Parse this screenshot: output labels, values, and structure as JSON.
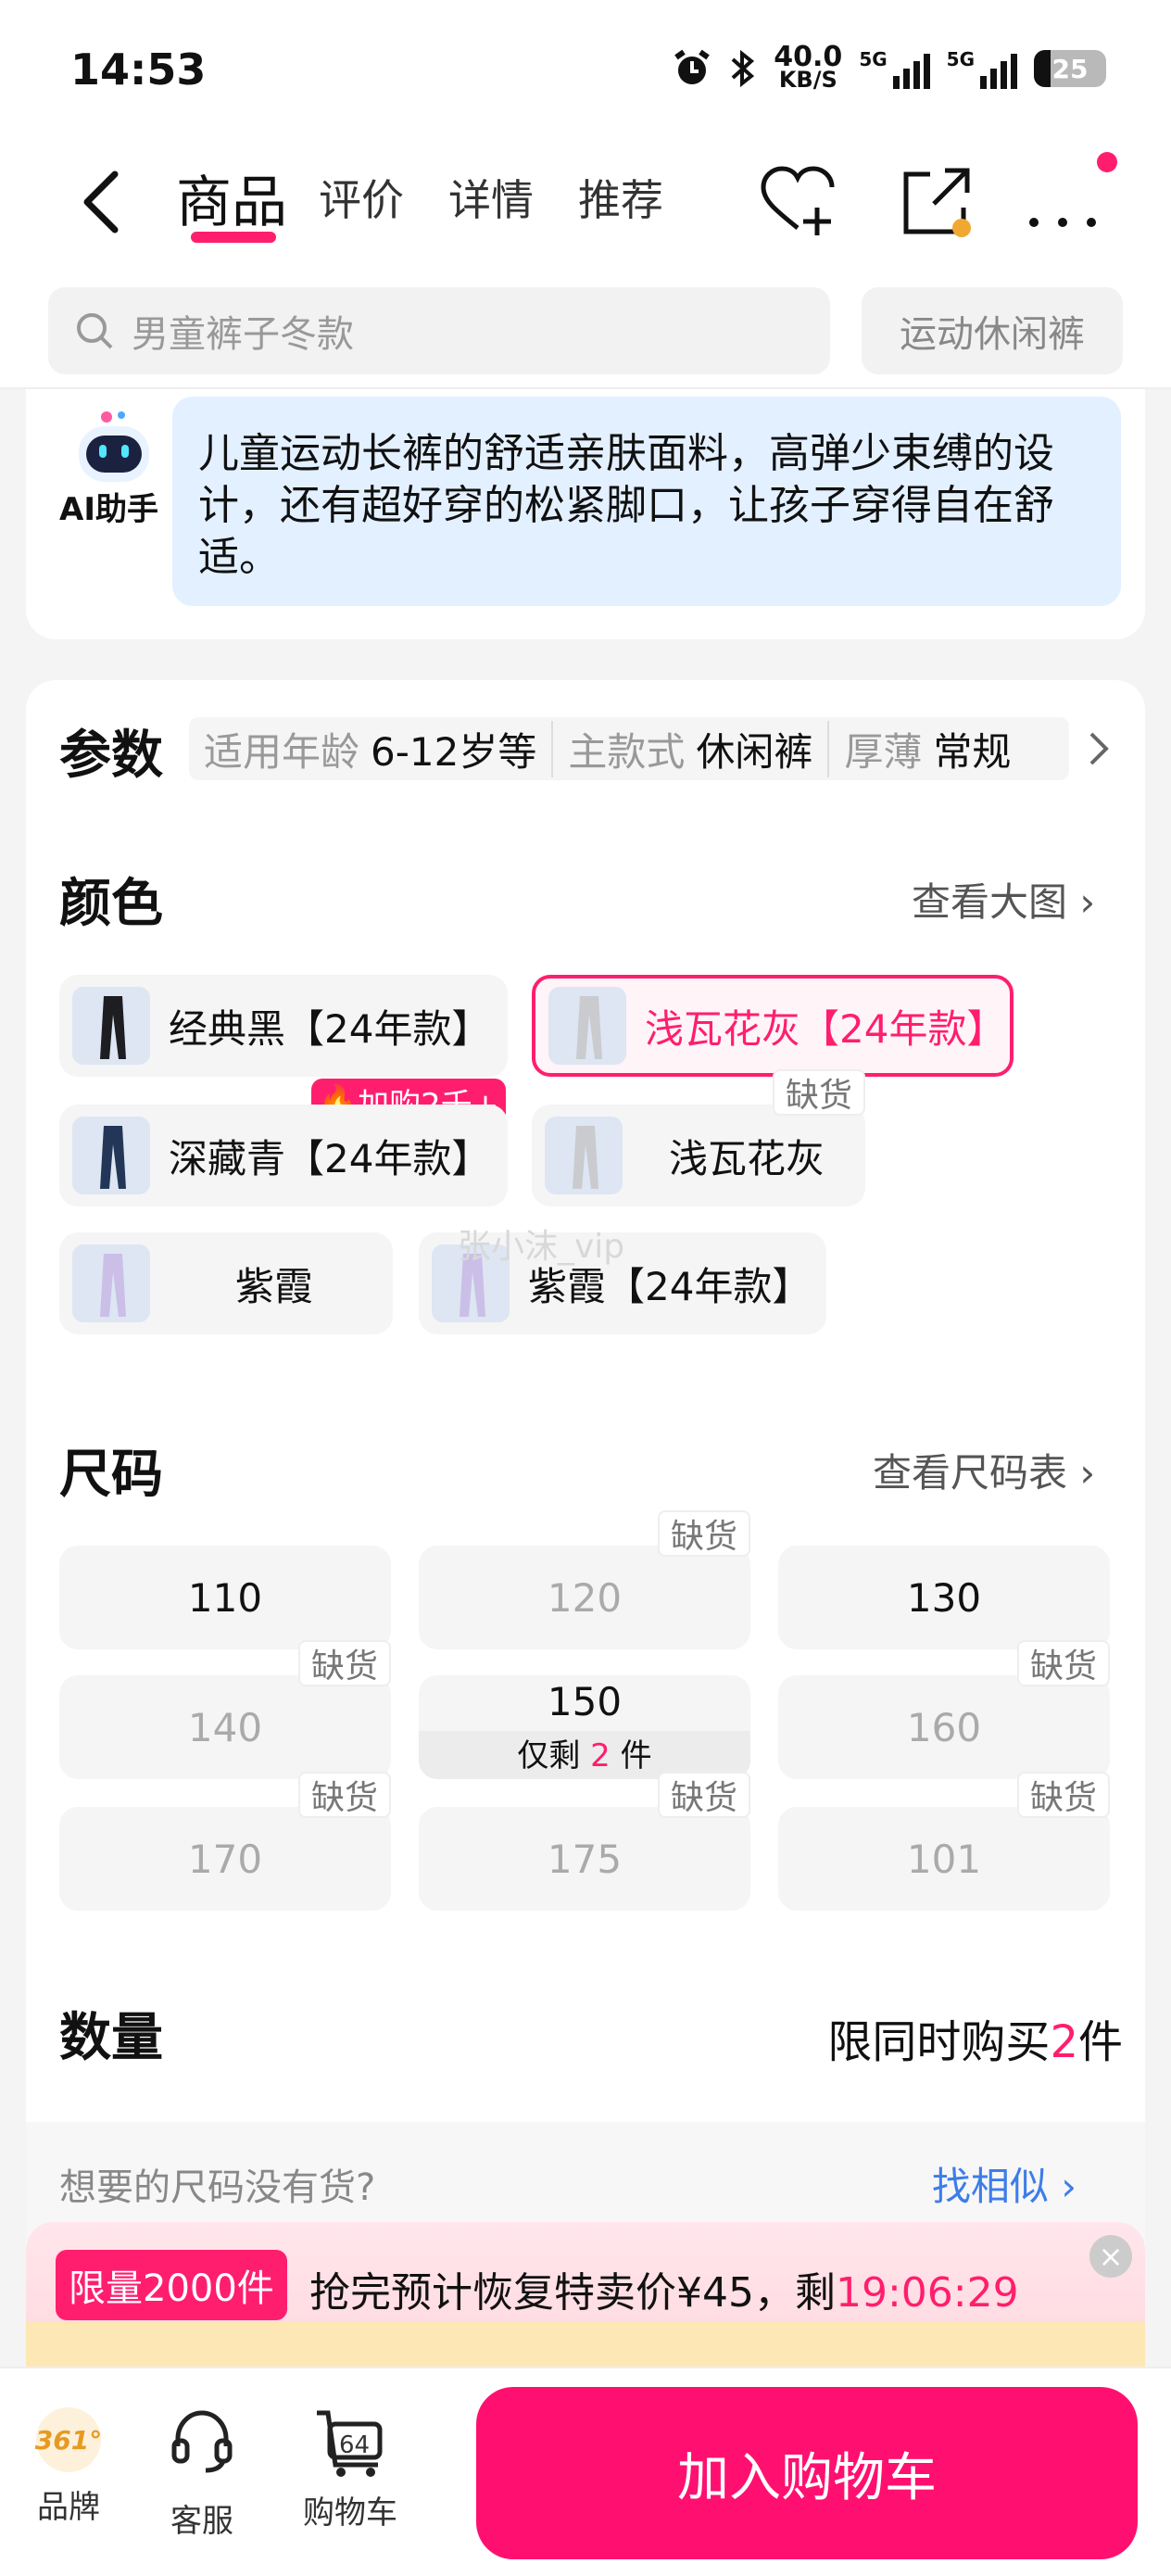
{
  "status": {
    "time": "14:53",
    "net_speed": "40.0",
    "net_unit": "KB/S",
    "sig1": "5G",
    "sig2": "5G",
    "battery": "25"
  },
  "nav": {
    "tabs": [
      "商品",
      "评价",
      "详情",
      "推荐"
    ]
  },
  "search": {
    "placeholder": "男童裤子冬款",
    "chip": "运动休闲裤"
  },
  "ai": {
    "label": "AI助手",
    "text": "儿童运动长裤的舒适亲肤面料，高弹少束缚的设计，还有超好穿的松紧脚口，让孩子穿得自在舒适。"
  },
  "params": {
    "title": "参数",
    "items": [
      {
        "k": "适用年龄",
        "v": "6-12岁等"
      },
      {
        "k": "主款式",
        "v": "休闲裤"
      },
      {
        "k": "厚薄",
        "v": "常规"
      }
    ]
  },
  "color": {
    "title": "颜色",
    "link": "查看大图",
    "options": [
      "经典黑【24年款】",
      "浅瓦花灰【24年款】",
      "深藏青【24年款】",
      "浅瓦花灰",
      "紫霞",
      "紫霞【24年款】"
    ],
    "hot_badge": "加购2千+",
    "oos": "缺货",
    "watermark": "张小沫_vip"
  },
  "size": {
    "title": "尺码",
    "link": "查看尺码表",
    "options": [
      "110",
      "120",
      "130",
      "140",
      "150",
      "160",
      "170",
      "175",
      "101"
    ],
    "oos": "缺货",
    "stock_prefix": "仅剩",
    "stock_count": "2",
    "stock_suffix": "件"
  },
  "quantity": {
    "title": "数量",
    "limit_prefix": "限同时购买",
    "limit_count": "2",
    "limit_suffix": "件"
  },
  "nosize": {
    "question": "想要的尺码没有货?",
    "link": "找相似"
  },
  "promo": {
    "tag": "限量2000件",
    "text": "抢完预计恢复特卖价¥45，剩",
    "countdown": "19:06:29"
  },
  "bottom": {
    "brand": "品牌",
    "brand_logo": "361°",
    "service": "客服",
    "cart": "购物车",
    "cart_count": "64",
    "add_to_cart": "加入购物车"
  },
  "colors": {
    "accent": "#ff1e6e",
    "link": "#3d7de8",
    "ai_bubble": "#e3f0ff"
  }
}
